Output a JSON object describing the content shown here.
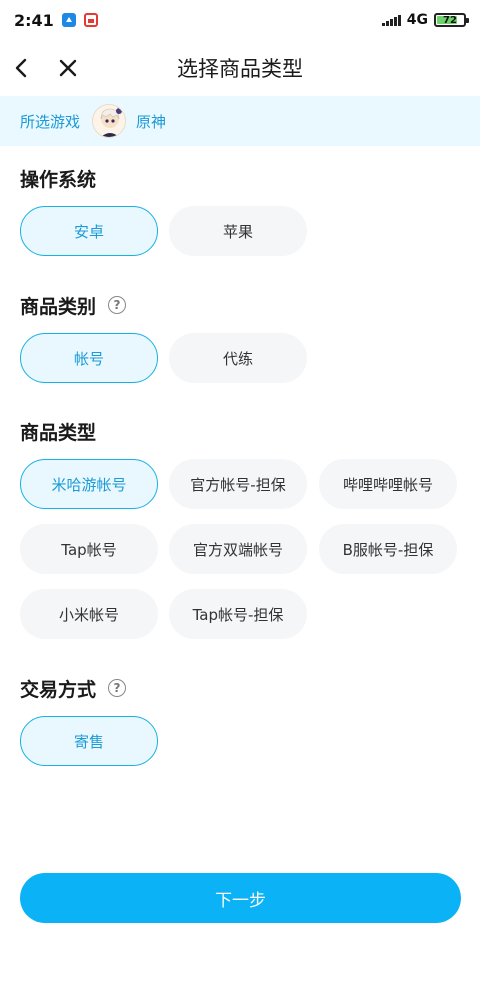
{
  "status_bar": {
    "time": "2:41",
    "network": "4G",
    "battery": "72",
    "battery_level": 0.72
  },
  "header": {
    "title": "选择商品类型"
  },
  "game": {
    "label": "所选游戏",
    "name": "原神"
  },
  "sections": {
    "os": {
      "title": "操作系统",
      "options": [
        "安卓",
        "苹果"
      ],
      "selected": "安卓"
    },
    "category": {
      "title": "商品类别",
      "options": [
        "帐号",
        "代练"
      ],
      "selected": "帐号"
    },
    "type": {
      "title": "商品类型",
      "options": [
        "米哈游帐号",
        "官方帐号-担保",
        "哔哩哔哩帐号",
        "Tap帐号",
        "官方双端帐号",
        "B服帐号-担保",
        "小米帐号",
        "Tap帐号-担保"
      ],
      "selected": "米哈游帐号"
    },
    "trade": {
      "title": "交易方式",
      "options": [
        "寄售"
      ],
      "selected": "寄售"
    }
  },
  "next_button": {
    "label": "下一步"
  },
  "colors": {
    "accent": "#0bb2f5",
    "selected_border": "#18b1e3",
    "selected_bg": "#e9f8ff",
    "banner_bg": "#eaf8ff"
  }
}
